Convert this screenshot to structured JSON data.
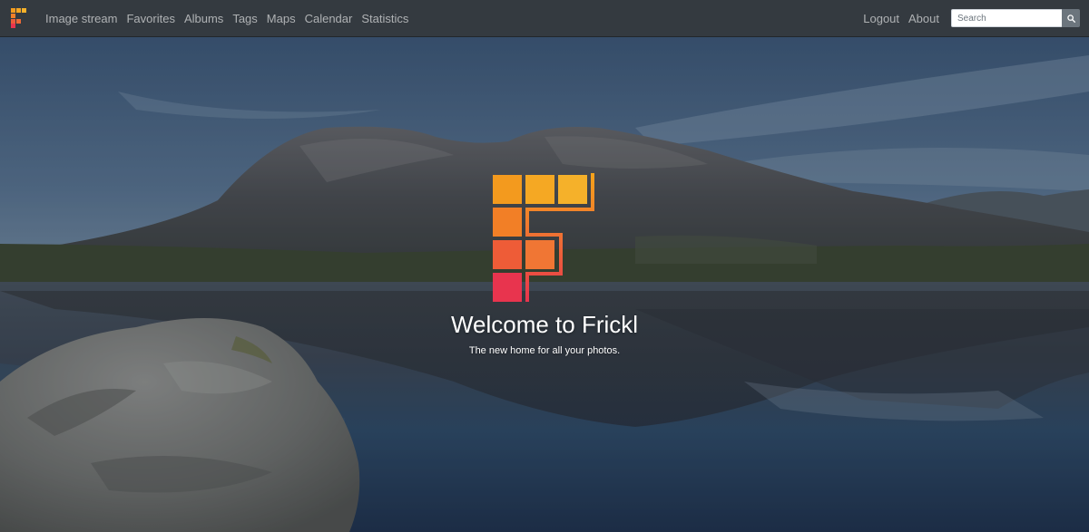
{
  "nav": {
    "items": [
      {
        "label": "Image stream"
      },
      {
        "label": "Favorites"
      },
      {
        "label": "Albums"
      },
      {
        "label": "Tags"
      },
      {
        "label": "Maps"
      },
      {
        "label": "Calendar"
      },
      {
        "label": "Statistics"
      }
    ],
    "right_items": [
      {
        "label": "Logout"
      },
      {
        "label": "About"
      }
    ],
    "search": {
      "placeholder": "Search",
      "value": "",
      "button_icon": "search-icon"
    }
  },
  "hero": {
    "title": "Welcome to Frickl",
    "subtitle": "The new home for all your photos.",
    "logo_icon": "frickl-logo-icon"
  },
  "colors": {
    "navbar_bg": "#343a40",
    "nav_text": "rgba(255,255,255,0.6)",
    "logo_orange": "#f5a31a",
    "logo_red": "#e8344e"
  }
}
